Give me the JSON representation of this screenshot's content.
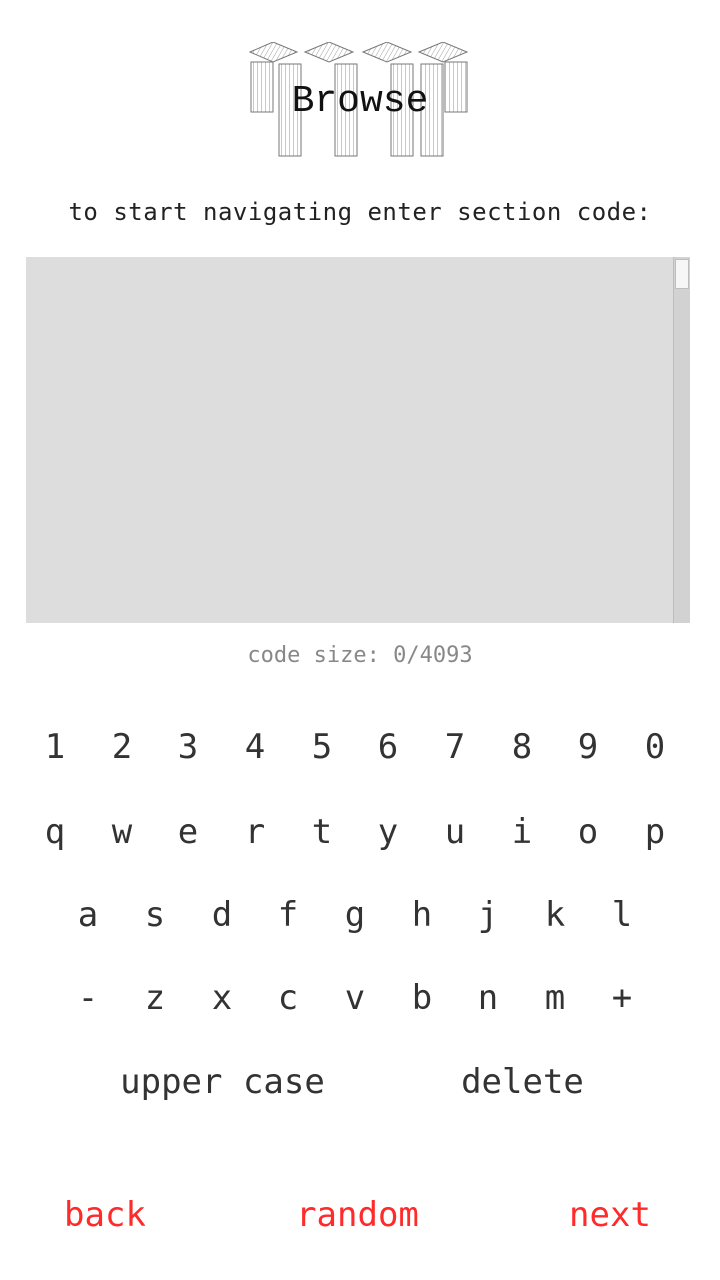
{
  "header": {
    "title": "Browse"
  },
  "prompt": "to start navigating enter section code:",
  "code_input": {
    "value": ""
  },
  "code_size": "code size: 0/4093",
  "keyboard": {
    "row1": [
      "1",
      "2",
      "3",
      "4",
      "5",
      "6",
      "7",
      "8",
      "9",
      "0"
    ],
    "row2": [
      "q",
      "w",
      "e",
      "r",
      "t",
      "y",
      "u",
      "i",
      "o",
      "p"
    ],
    "row3": [
      "a",
      "s",
      "d",
      "f",
      "g",
      "h",
      "j",
      "k",
      "l"
    ],
    "row4": [
      "-",
      "z",
      "x",
      "c",
      "v",
      "b",
      "n",
      "m",
      "+"
    ],
    "upper_case": "upper case",
    "delete": "delete"
  },
  "nav": {
    "back": "back",
    "random": "random",
    "next": "next"
  },
  "colors": {
    "nav": "#ff2a2a",
    "input_bg": "#dddddd",
    "muted_text": "#888888"
  }
}
